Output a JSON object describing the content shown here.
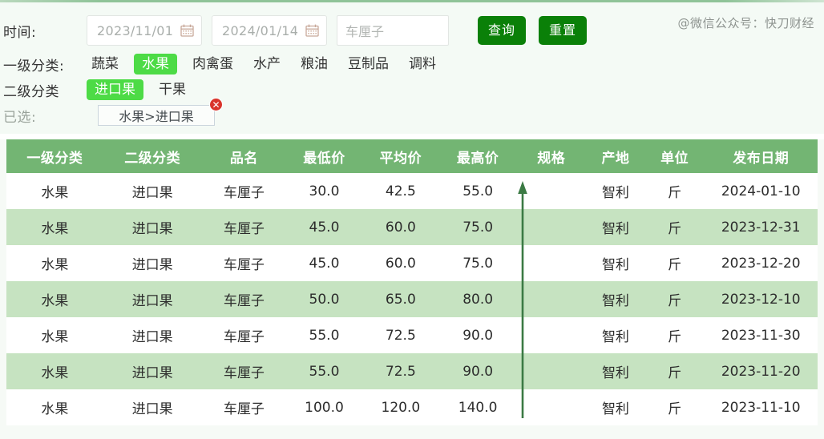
{
  "watermark": "@微信公众号：快刀财经",
  "filters": {
    "time_label": "时间:",
    "date_from": "2023/11/01",
    "date_to": "2024/01/14",
    "calendar_icon": "calendar-icon",
    "search_value": "车厘子",
    "query_button": "查询",
    "reset_button": "重置",
    "cat1_label": "一级分类:",
    "cat1_options": [
      {
        "label": "蔬菜",
        "selected": false
      },
      {
        "label": "水果",
        "selected": true
      },
      {
        "label": "肉禽蛋",
        "selected": false
      },
      {
        "label": "水产",
        "selected": false
      },
      {
        "label": "粮油",
        "selected": false
      },
      {
        "label": "豆制品",
        "selected": false
      },
      {
        "label": "调料",
        "selected": false
      }
    ],
    "cat2_label": "二级分类",
    "cat2_options": [
      {
        "label": "进口果",
        "selected": true
      },
      {
        "label": "干果",
        "selected": false
      }
    ],
    "selected_label": "已选:",
    "selected_chip": "水果>进口果",
    "chip_close_icon": "circle-close-icon"
  },
  "table": {
    "headers": [
      "一级分类",
      "二级分类",
      "品名",
      "最低价",
      "平均价",
      "最高价",
      "规格",
      "产地",
      "单位",
      "发布日期"
    ],
    "rows": [
      {
        "cat1": "水果",
        "cat2": "进口果",
        "name": "车厘子",
        "min": "30.0",
        "avg": "42.5",
        "max": "55.0",
        "spec": "",
        "origin": "智利",
        "unit": "斤",
        "date": "2024-01-10"
      },
      {
        "cat1": "水果",
        "cat2": "进口果",
        "name": "车厘子",
        "min": "45.0",
        "avg": "60.0",
        "max": "75.0",
        "spec": "",
        "origin": "智利",
        "unit": "斤",
        "date": "2023-12-31"
      },
      {
        "cat1": "水果",
        "cat2": "进口果",
        "name": "车厘子",
        "min": "45.0",
        "avg": "60.0",
        "max": "75.0",
        "spec": "",
        "origin": "智利",
        "unit": "斤",
        "date": "2023-12-20"
      },
      {
        "cat1": "水果",
        "cat2": "进口果",
        "name": "车厘子",
        "min": "50.0",
        "avg": "65.0",
        "max": "80.0",
        "spec": "",
        "origin": "智利",
        "unit": "斤",
        "date": "2023-12-10"
      },
      {
        "cat1": "水果",
        "cat2": "进口果",
        "name": "车厘子",
        "min": "55.0",
        "avg": "72.5",
        "max": "90.0",
        "spec": "",
        "origin": "智利",
        "unit": "斤",
        "date": "2023-11-30"
      },
      {
        "cat1": "水果",
        "cat2": "进口果",
        "name": "车厘子",
        "min": "55.0",
        "avg": "72.5",
        "max": "90.0",
        "spec": "",
        "origin": "智利",
        "unit": "斤",
        "date": "2023-11-20"
      },
      {
        "cat1": "水果",
        "cat2": "进口果",
        "name": "车厘子",
        "min": "100.0",
        "avg": "120.0",
        "max": "140.0",
        "spec": "",
        "origin": "智利",
        "unit": "斤",
        "date": "2023-11-10"
      }
    ]
  },
  "annotation": {
    "arrow_icon": "up-arrow-annotation",
    "arrow_color": "#3b7a44"
  },
  "colors": {
    "header_green": "#73b573",
    "stripe_green": "#c6e3c1",
    "button_green": "#0a8008",
    "tag_green": "#4ddb46",
    "panel_bg": "#f4faf5"
  }
}
